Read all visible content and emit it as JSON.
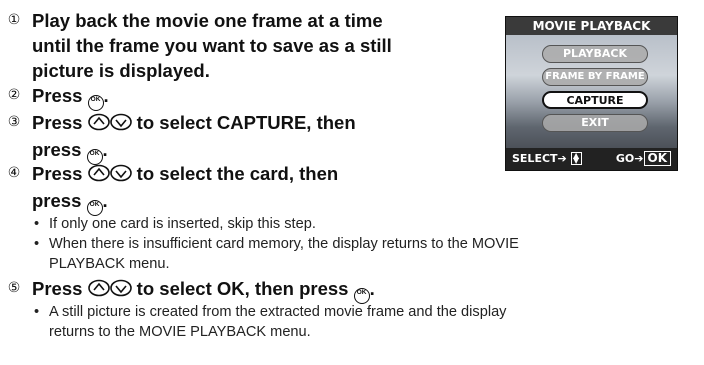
{
  "steps": [
    {
      "number": "①",
      "lines": [
        "Play back the movie one frame at a time",
        "until the frame you want to save as a still",
        "picture is displayed."
      ]
    },
    {
      "number": "②",
      "before": "Press ",
      "after": "."
    },
    {
      "number": "③",
      "before": "Press ",
      "after": " to select CAPTURE, then",
      "line2_before": "press ",
      "line2_after": "."
    },
    {
      "number": "④",
      "before": "Press ",
      "after": " to select the card, then",
      "line2_before": "press ",
      "line2_after": ".",
      "bullets": [
        "If only one card is inserted, skip this step.",
        "When there is insufficient card memory, the display returns to the MOVIE",
        "PLAYBACK menu."
      ]
    },
    {
      "number": "⑤",
      "before": "Press ",
      "after": " to select OK, then press ",
      "end": ".",
      "bullets": [
        "A still picture is created from the extracted movie frame and the display",
        "returns to the MOVIE PLAYBACK menu."
      ]
    }
  ],
  "bullet_symbol": "•",
  "ok_symbol": "OK",
  "screen": {
    "title": "MOVIE PLAYBACK",
    "items": [
      "PLAYBACK",
      "FRAME BY FRAME",
      "CAPTURE",
      "EXIT"
    ],
    "selected": "CAPTURE",
    "select_label": "SELECT➔",
    "go_label": "GO➔",
    "ok_label": "OK"
  }
}
